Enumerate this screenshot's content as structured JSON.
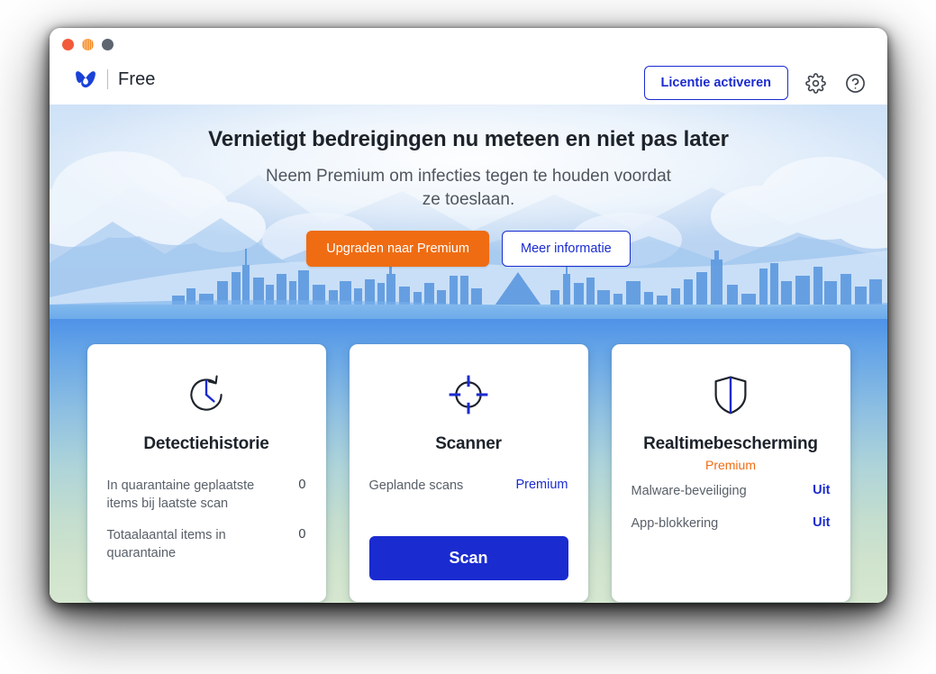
{
  "window": {
    "traffic_lights": [
      {
        "name": "close",
        "color": "#f15a3a"
      },
      {
        "name": "minimize",
        "color": "#f3871c"
      },
      {
        "name": "maximize",
        "color": "#5c6570"
      }
    ]
  },
  "titlebar": {
    "logo_icon": "malwarebytes-m-logo",
    "edition": "Free",
    "activate_license_label": "Licentie activeren",
    "settings_icon": "gear-icon",
    "help_icon": "question-mark-circle-icon"
  },
  "hero": {
    "headline": "Vernietigt bedreigingen nu meteen en niet pas later",
    "subtitle_line1": "Neem Premium om infecties tegen te houden voordat",
    "subtitle_line2": "ze toeslaan.",
    "primary_button": "Upgraden naar Premium",
    "secondary_button": "Meer informatie"
  },
  "cards": [
    {
      "id": "detection-history",
      "icon": "clock-history-icon",
      "title": "Detectiehistorie",
      "subtitle": null,
      "rows": [
        {
          "label": "In quarantaine geplaatste items bij laatste scan",
          "value": "0",
          "style": "plain"
        },
        {
          "label": "Totaalaantal items in quarantaine",
          "value": "0",
          "style": "plain"
        }
      ],
      "button": null
    },
    {
      "id": "scanner",
      "icon": "crosshair-target-icon",
      "title": "Scanner",
      "subtitle": null,
      "rows": [
        {
          "label": "Geplande scans",
          "value": "Premium",
          "style": "premium"
        }
      ],
      "button": "Scan"
    },
    {
      "id": "real-time-protection",
      "icon": "shield-icon",
      "title": "Realtimebescherming",
      "subtitle": "Premium",
      "rows": [
        {
          "label": "Malware-beveiliging",
          "value": "Uit",
          "style": "link"
        },
        {
          "label": "App-blokkering",
          "value": "Uit",
          "style": "link"
        }
      ],
      "button": null
    }
  ],
  "colors": {
    "brand_blue": "#1a2bd0",
    "accent_orange": "#ef6c12",
    "text_dark": "#1d232b",
    "text_muted": "#596069"
  }
}
